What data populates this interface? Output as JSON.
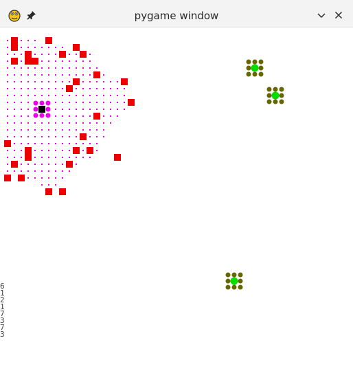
{
  "window": {
    "title": "pygame window",
    "app_icon": "pygame-snake-icon",
    "pin_icon": "pin-icon",
    "minimize_icon": "chevron-down-icon",
    "close_icon": "close-icon"
  },
  "background_leak": {
    "chars": [
      "6",
      "1",
      "2",
      "1",
      "7",
      "3",
      "7",
      "3"
    ]
  },
  "game": {
    "colors": {
      "obstacle": "#ee0000",
      "trail": "#ee00ee",
      "player": "#000000",
      "player_ring": "#ee00ee",
      "target": "#00dd00",
      "target_ring": "#666600",
      "background": "#ffffff"
    },
    "cell_size": 10,
    "obstacles": [
      [
        1,
        1
      ],
      [
        6,
        1
      ],
      [
        1,
        2
      ],
      [
        10,
        2
      ],
      [
        3,
        3
      ],
      [
        8,
        3
      ],
      [
        11,
        3
      ],
      [
        1,
        4
      ],
      [
        3,
        4
      ],
      [
        4,
        4
      ],
      [
        13,
        6
      ],
      [
        17,
        7
      ],
      [
        10,
        7
      ],
      [
        9,
        8
      ],
      [
        18,
        10
      ],
      [
        13,
        12
      ],
      [
        11,
        15
      ],
      [
        0,
        16
      ],
      [
        3,
        17
      ],
      [
        10,
        17
      ],
      [
        12,
        17
      ],
      [
        3,
        18
      ],
      [
        16,
        18
      ],
      [
        1,
        19
      ],
      [
        9,
        19
      ],
      [
        0,
        21
      ],
      [
        2,
        21
      ],
      [
        6,
        23
      ],
      [
        8,
        23
      ]
    ],
    "player": [
      5,
      11
    ],
    "targets": [
      [
        36,
        5
      ],
      [
        39,
        9
      ],
      [
        33,
        36
      ]
    ],
    "trail_rows": [
      [
        0,
        1,
        4
      ],
      [
        0,
        2,
        8
      ],
      [
        0,
        3,
        12
      ],
      [
        0,
        4,
        12
      ],
      [
        0,
        5,
        13
      ],
      [
        0,
        6,
        14
      ],
      [
        0,
        7,
        16
      ],
      [
        0,
        8,
        17
      ],
      [
        0,
        9,
        17
      ],
      [
        0,
        10,
        18
      ],
      [
        0,
        11,
        17
      ],
      [
        0,
        12,
        16
      ],
      [
        0,
        13,
        15
      ],
      [
        0,
        14,
        14
      ],
      [
        0,
        15,
        14
      ],
      [
        0,
        16,
        13
      ],
      [
        0,
        17,
        13
      ],
      [
        0,
        18,
        12
      ],
      [
        0,
        19,
        10
      ],
      [
        0,
        20,
        9
      ],
      [
        3,
        21,
        8
      ],
      [
        5,
        22,
        7
      ]
    ]
  }
}
